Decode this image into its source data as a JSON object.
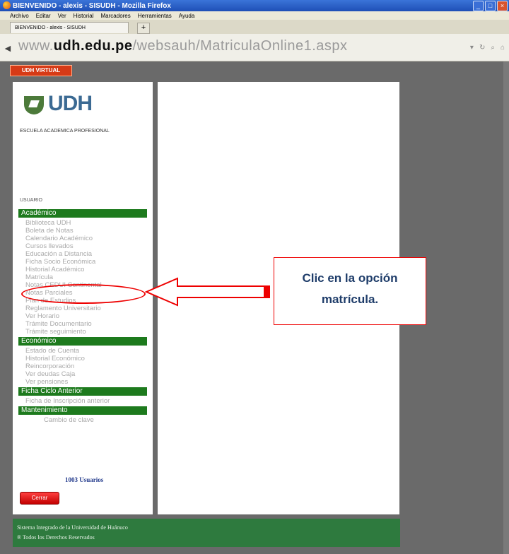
{
  "window": {
    "title": "BIENVENIDO - alexis - SISUDH - Mozilla Firefox"
  },
  "menubar": [
    "Archivo",
    "Editar",
    "Ver",
    "Historial",
    "Marcadores",
    "Herramientas",
    "Ayuda"
  ],
  "tab": {
    "label": "BIENVENIDO - alexis - SISUDH",
    "new_tab": "+"
  },
  "address": {
    "prefix": "www.",
    "domain": "udh.edu.pe",
    "path": "/websauh/MatriculaOnline1.aspx"
  },
  "header": {
    "badge": "UDH VIRTUAL"
  },
  "sidebar": {
    "logo_text": "UDH",
    "school": "ESCUELA ACADEMICA PROFESIONAL",
    "user_label": "USUARIO",
    "sections": [
      {
        "title": "Académico",
        "items": [
          "Biblioteca UDH",
          "Boleta de Notas",
          "Calendario Académico",
          "Cursos llevados",
          "Educación a Distancia",
          "Ficha Socio Económica",
          "Historial Académico",
          "Matrícula",
          "Notas CEDUI Continental",
          "Notas Parciales",
          "Plan de Estudios",
          "Reglamento Universitario",
          "Ver Horario",
          "Trámite Documentario",
          "Trámite seguimiento"
        ]
      },
      {
        "title": "Económico",
        "items": [
          "Estado de Cuenta",
          "Historial Económico",
          "Reincorporación",
          "Ver deudas Caja",
          "Ver pensiones"
        ]
      },
      {
        "title": "Ficha Ciclo Anterior",
        "items": [
          "Ficha de Inscripción anterior"
        ]
      },
      {
        "title": "Mantenimiento",
        "items": [
          "Cambio de clave"
        ]
      }
    ],
    "users_link": "1003  Usuarios",
    "logout": "Cerrar"
  },
  "footer": {
    "line1": "Sistema Integrado de la Universidad de Huánuco",
    "line2": "® Todos los Derechos Reservados"
  },
  "callout": {
    "line1": "Clic en la opción",
    "line2": "matrícula."
  },
  "colors": {
    "section_bg": "#1d7a1d",
    "footer_bg": "#2e7a3e",
    "annotation": "#e00000",
    "badge": "#d63a16"
  }
}
